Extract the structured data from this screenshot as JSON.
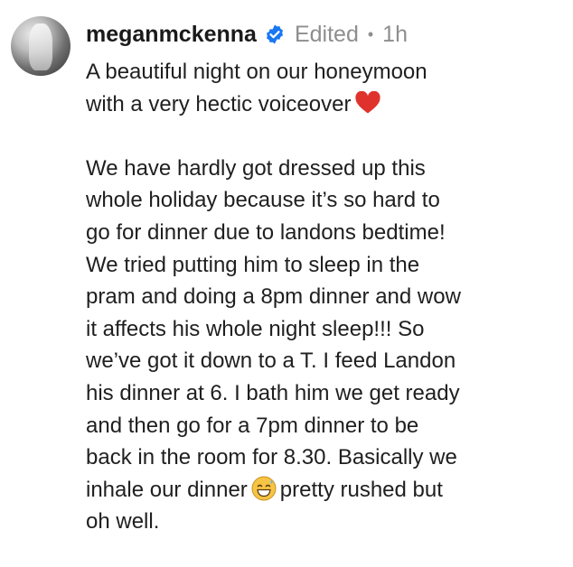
{
  "comment": {
    "username": "meganmckenna",
    "edited_label": "Edited",
    "separator": "•",
    "time": "1h",
    "lines_para1": [
      "A beautiful night on our honeymoon",
      "with a very hectic voiceover"
    ],
    "lines_para2": [
      "We have hardly got dressed up this",
      "whole holiday because it’s so hard to",
      "go for dinner due to landons bedtime!",
      "We tried putting him to sleep in the",
      "pram and doing a 8pm dinner and wow",
      "it affects his whole night sleep!!! So",
      "we’ve got it down to a T. I feed Landon",
      "his dinner at 6. I bath him we get ready",
      "and then go for a 7pm dinner to be",
      "back in the room for 8.30. Basically we"
    ],
    "line_emoji_before": "inhale our dinner",
    "line_emoji_after": "pretty rushed but",
    "last_line": "oh well.",
    "icons": {
      "verified": "verified-badge-icon",
      "heart": "red-heart-emoji",
      "grin_sweat": "grinning-sweat-emoji"
    },
    "colors": {
      "verified": "#1a77f2",
      "heart": "#e0322d",
      "muted": "#8e8e8e"
    }
  }
}
